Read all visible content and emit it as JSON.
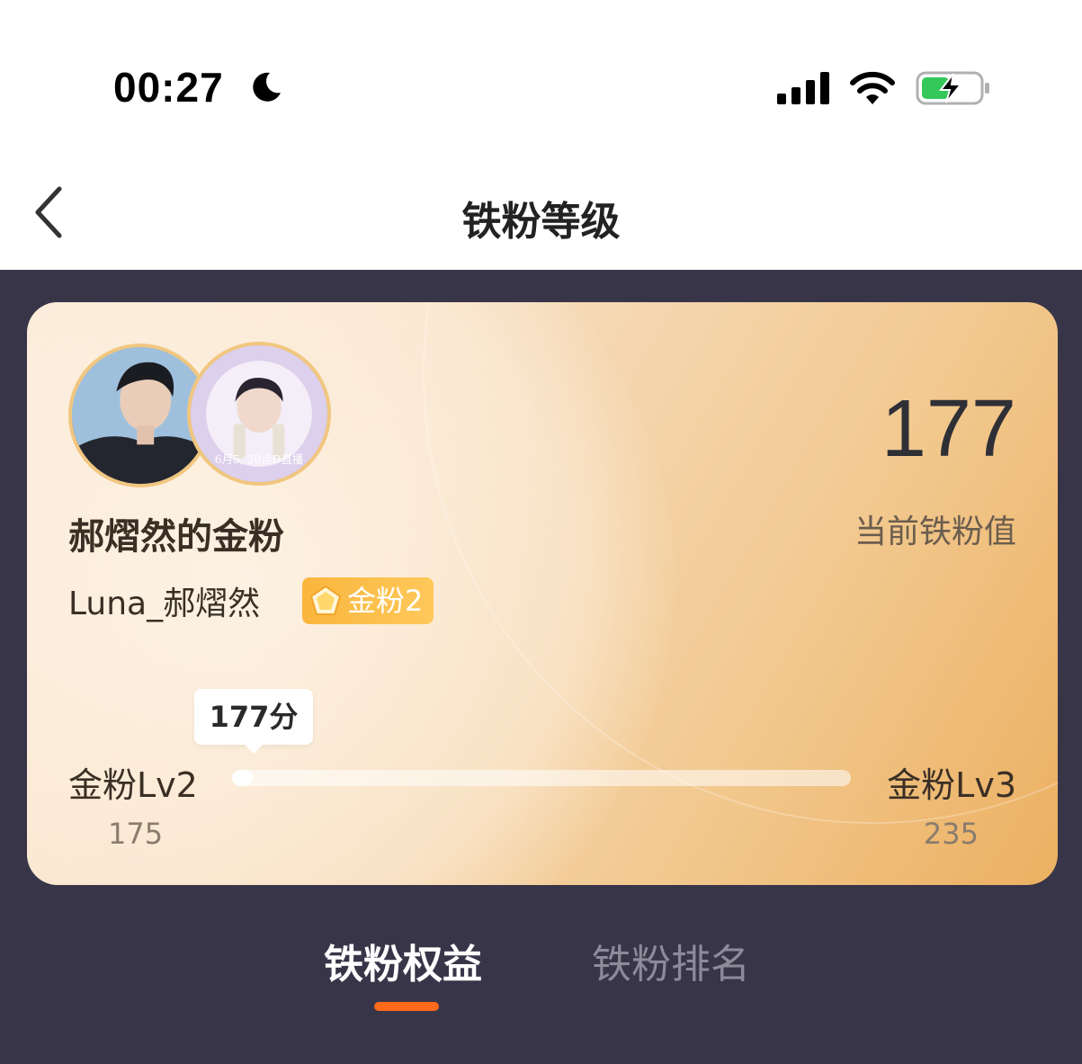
{
  "status_bar": {
    "time": "00:27",
    "icons": [
      "moon-icon",
      "cellular-signal-icon",
      "wifi-icon",
      "battery-charging-icon"
    ]
  },
  "nav": {
    "back_icon": "chevron-left-icon",
    "title": "铁粉等级"
  },
  "card": {
    "fan_title": "郝熠然的金粉",
    "username": "Luna_郝熠然",
    "badge": {
      "label": "金粉2",
      "icon": "gold-gem-icon",
      "color": "#f9b63e"
    },
    "avatars": [
      "user-avatar",
      "idol-avatar"
    ],
    "avatar_text": "6月5, 20点D直播",
    "score": {
      "value": "177",
      "label": "当前铁粉值"
    },
    "progress": {
      "tooltip": "177分",
      "current_level": "金粉Lv2",
      "next_level": "金粉Lv3",
      "min": "175",
      "max": "235",
      "current": 177
    }
  },
  "tabs": [
    {
      "label": "铁粉权益",
      "active": true
    },
    {
      "label": "铁粉排名",
      "active": false
    }
  ],
  "colors": {
    "dark_bg": "#393549",
    "accent": "#ff6a1a",
    "card_gradient_end": "#ecb061"
  }
}
